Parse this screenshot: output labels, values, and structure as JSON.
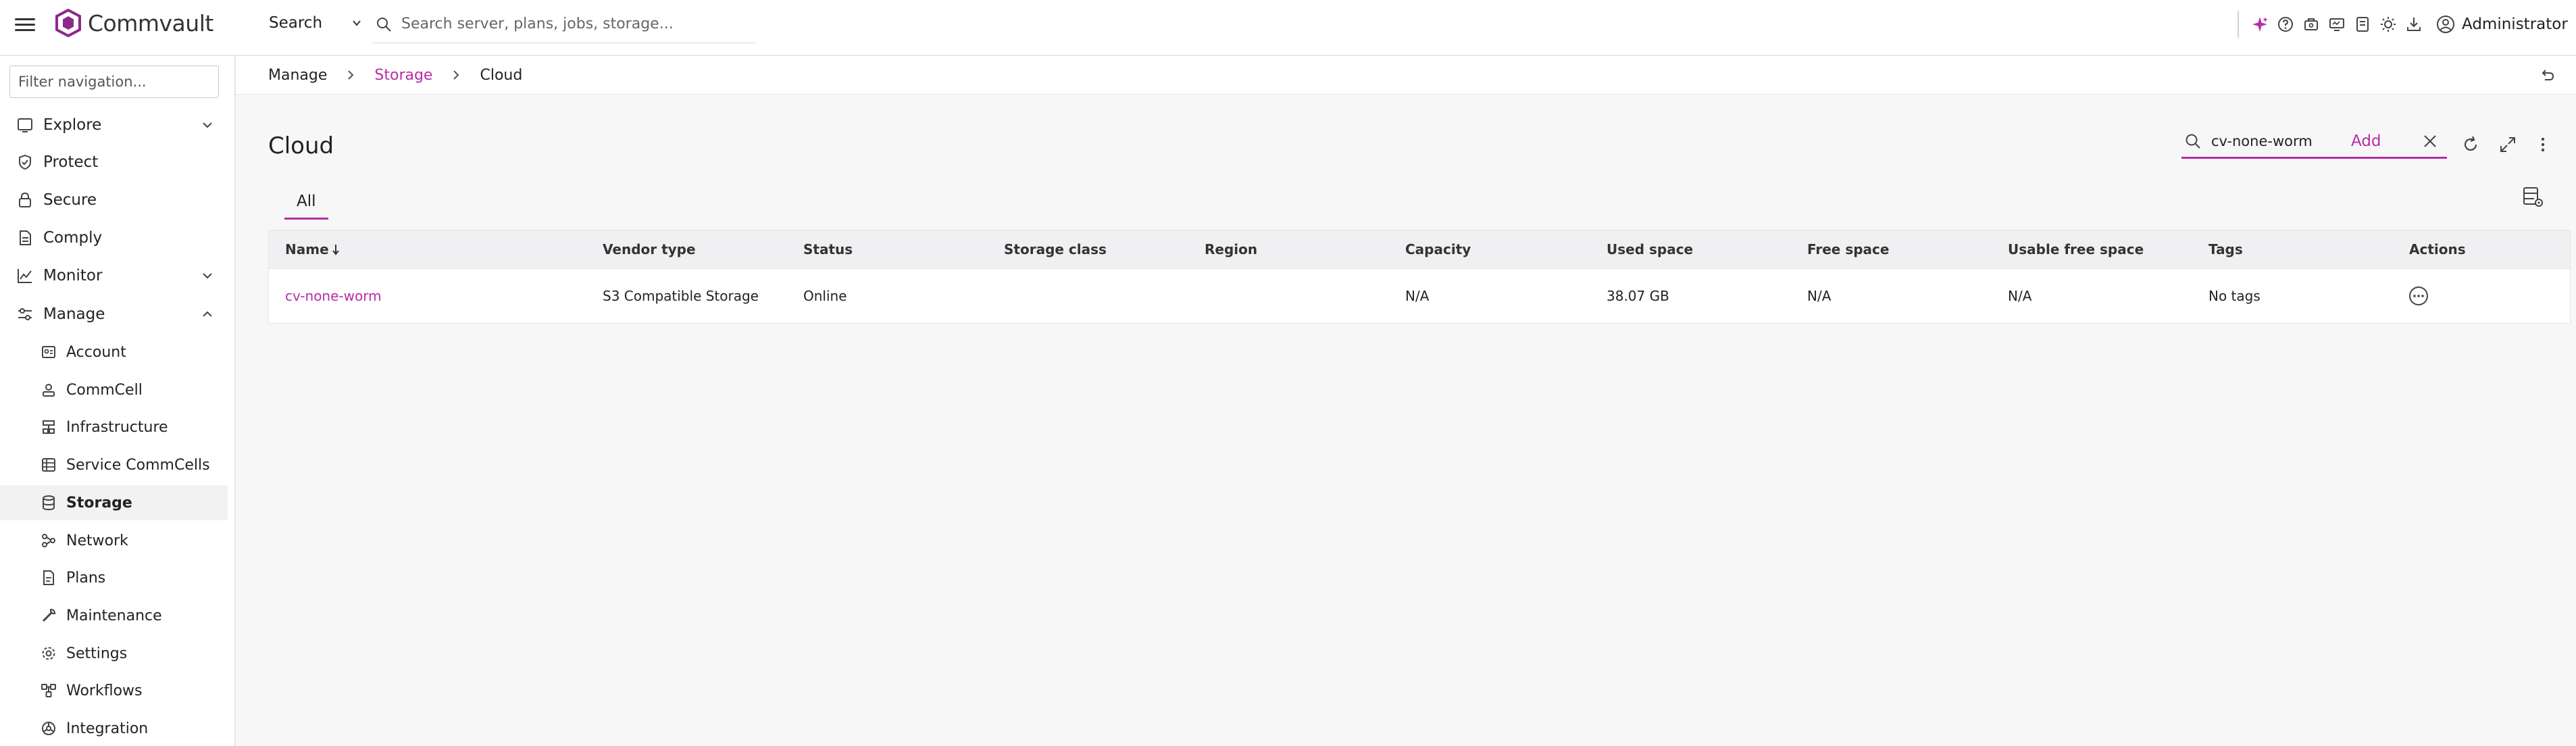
{
  "topbar": {
    "brand": "Commvault",
    "search_type": "Search",
    "search_placeholder": "Search server, plans, jobs, storage...",
    "user": "Administrator"
  },
  "sidebar": {
    "filter_placeholder": "Filter navigation...",
    "items": [
      {
        "label": "Explore",
        "icon": "explore-icon"
      },
      {
        "label": "Protect",
        "icon": "shield-icon"
      },
      {
        "label": "Secure",
        "icon": "lock-icon"
      },
      {
        "label": "Comply",
        "icon": "document-icon"
      },
      {
        "label": "Monitor",
        "icon": "chart-icon"
      },
      {
        "label": "Manage",
        "icon": "sliders-icon"
      }
    ],
    "sub_items": [
      {
        "label": "Account",
        "icon": "account-icon"
      },
      {
        "label": "CommCell",
        "icon": "commcell-icon"
      },
      {
        "label": "Infrastructure",
        "icon": "infrastructure-icon"
      },
      {
        "label": "Service CommCells",
        "icon": "service-commcells-icon"
      },
      {
        "label": "Storage",
        "icon": "storage-icon"
      },
      {
        "label": "Network",
        "icon": "network-icon"
      },
      {
        "label": "Plans",
        "icon": "plans-icon"
      },
      {
        "label": "Maintenance",
        "icon": "wrench-icon"
      },
      {
        "label": "Settings",
        "icon": "gear-icon"
      },
      {
        "label": "Workflows",
        "icon": "workflow-icon"
      },
      {
        "label": "Integration",
        "icon": "integration-icon"
      }
    ]
  },
  "breadcrumb": {
    "items": [
      "Manage",
      "Storage",
      "Cloud"
    ]
  },
  "page": {
    "title": "Cloud",
    "add_label": "Add",
    "search_value": "cv-none-worm",
    "tabs": [
      "All"
    ]
  },
  "table": {
    "columns": [
      "Name",
      "Vendor type",
      "Status",
      "Storage class",
      "Region",
      "Capacity",
      "Used space",
      "Free space",
      "Usable free space",
      "Tags",
      "Actions"
    ],
    "rows": [
      {
        "name": "cv-none-worm",
        "vendor_type": "S3 Compatible Storage",
        "status": "Online",
        "storage_class": "",
        "region": "",
        "capacity": "N/A",
        "used_space": "38.07 GB",
        "free_space": "N/A",
        "usable_free_space": "N/A",
        "tags": "No tags"
      }
    ]
  },
  "colors": {
    "accent": "#b82ca8",
    "header_bg": "#f0f0f2",
    "page_bg": "#f7f7f8"
  }
}
